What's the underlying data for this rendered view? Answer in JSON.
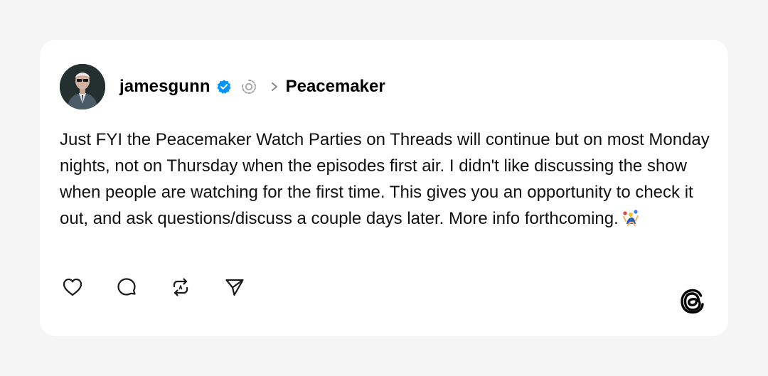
{
  "post": {
    "author": {
      "username": "jamesgunn",
      "verified_icon": "verified-badge-icon",
      "profile_icon": "threads-profile-icon"
    },
    "community": {
      "separator_icon": "chevron-right-icon",
      "name": "Peacemaker"
    },
    "text": "Just FYI the Peacemaker Watch Parties on Threads will continue but on most Monday nights, not on Thursday when the episodes first air. I didn't like discussing the show when people are watching for the first time. This gives you an opportunity to check it out, and ask questions/discuss a couple days later. More info forthcoming.",
    "emoji": "person-juggling-emoji",
    "actions": [
      {
        "name": "like",
        "icon": "heart-icon"
      },
      {
        "name": "reply",
        "icon": "comment-icon"
      },
      {
        "name": "repost",
        "icon": "repost-icon"
      },
      {
        "name": "share",
        "icon": "send-icon"
      }
    ],
    "brand_icon": "threads-logo-icon"
  },
  "colors": {
    "page_background": "#f5f5f5",
    "card_background": "#ffffff",
    "verified_blue": "#0095f6",
    "muted_gray": "#999999",
    "text": "#111111"
  }
}
